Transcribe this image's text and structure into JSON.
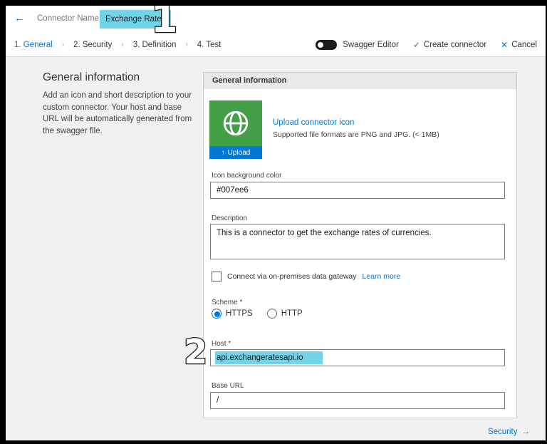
{
  "header": {
    "back_icon": "←",
    "connector_name_label": "Connector Name",
    "connector_name_value": "Exchange Rates"
  },
  "tabs": [
    {
      "label": "1. General",
      "active": true
    },
    {
      "label": "2. Security",
      "active": false
    },
    {
      "label": "3. Definition",
      "active": false
    },
    {
      "label": "4. Test",
      "active": false
    }
  ],
  "toolbar": {
    "swagger_editor_label": "Swagger Editor",
    "check_icon": "✓",
    "create_connector_label": "Create connector",
    "cancel_icon": "✕",
    "cancel_label": "Cancel"
  },
  "sidebar": {
    "title": "General information",
    "description": "Add an icon and short description to your custom connector. Your host and base URL will be automatically generated from the swagger file."
  },
  "panel": {
    "header_title": "General information",
    "upload_icon": "↑",
    "upload_button_label": "Upload",
    "upload_link": "Upload connector icon",
    "upload_hint": "Supported file formats are PNG and JPG. (< 1MB)",
    "icon_bg_label": "Icon background color",
    "icon_bg_value": "#007ee6",
    "description_label": "Description",
    "description_value": "This is a connector to get the exchange rates of currencies.",
    "gateway_checkbox_label": "Connect via on-premises data gateway",
    "learn_more_link": "Learn more",
    "scheme_label": "Scheme *",
    "scheme_options": [
      "HTTPS",
      "HTTP"
    ],
    "scheme_selected": "HTTPS",
    "host_label": "Host *",
    "host_value": "api.exchangeratesapi.io",
    "base_url_label": "Base URL",
    "base_url_value": "/"
  },
  "footer": {
    "security_link": "Security",
    "arrow_icon": "→"
  },
  "annotations": {
    "step_1": "1",
    "step_2": "2"
  },
  "colors": {
    "accent": "#0078d4",
    "highlight": "#72d4e8",
    "icon-green": "#43a047",
    "panel-bg": "#f1f1f1"
  }
}
